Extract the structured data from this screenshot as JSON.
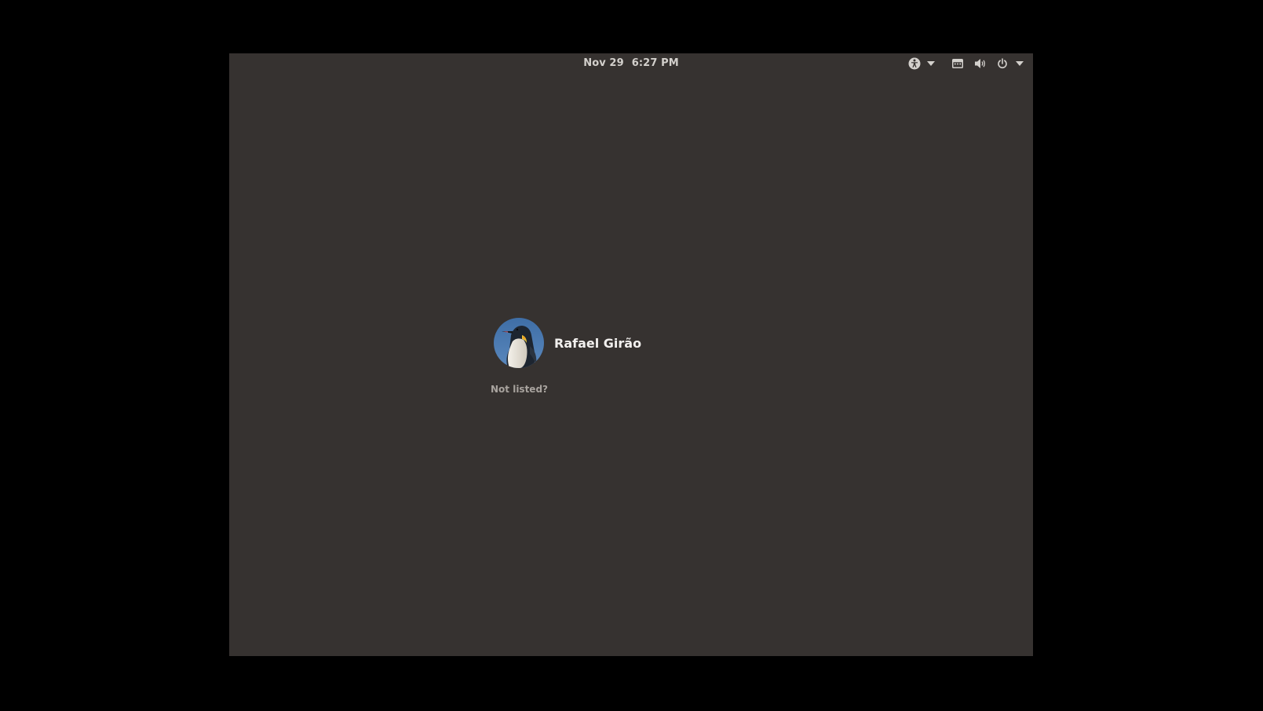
{
  "topbar": {
    "date": "Nov 29",
    "time": "6:27 PM",
    "icons": {
      "accessibility": "accessibility-icon",
      "accessibility_menu": "chevron-down-icon",
      "keyboard": "keyboard-icon",
      "volume": "volume-icon",
      "power": "power-icon",
      "power_menu": "chevron-down-icon"
    }
  },
  "login": {
    "user_name": "Rafael Girão",
    "avatar_icon": "penguin-avatar",
    "not_listed_label": "Not listed?"
  },
  "colors": {
    "desktop_background": "#363230",
    "letterbox": "#000000",
    "text_primary": "#f2f0ee",
    "text_secondary": "#a8a39e",
    "topbar_text": "#d3d0cc"
  }
}
